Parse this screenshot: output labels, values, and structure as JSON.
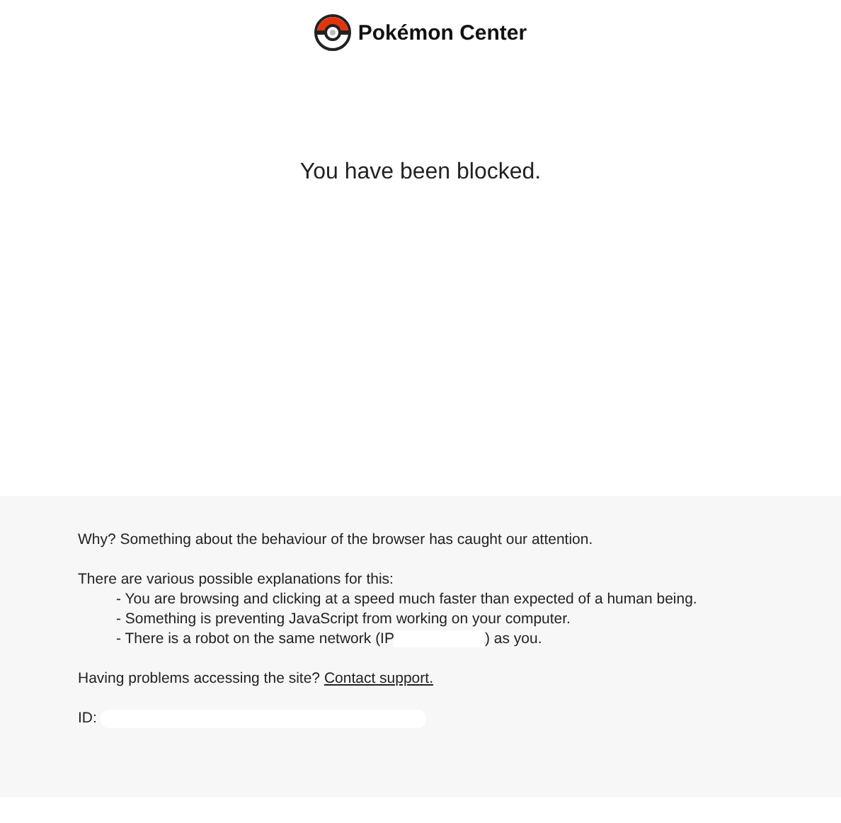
{
  "header": {
    "logo_text": "Pokémon Center"
  },
  "message": "You have been blocked.",
  "details": {
    "why": "Why? Something about the behaviour of the browser has caught our attention.",
    "intro": "There are various possible explanations for this:",
    "reasons": [
      {
        "text": "- You are browsing and clicking at a speed much faster than expected of a human being."
      },
      {
        "text": "- Something is preventing JavaScript from working on your computer."
      },
      {
        "text_before": "- There is a robot on the same network (IP",
        "text_after": ") as you.",
        "kind": "redacted"
      }
    ],
    "help": "Having problems accessing the site?",
    "help_link": "Contact support.",
    "id_label": "ID:"
  }
}
